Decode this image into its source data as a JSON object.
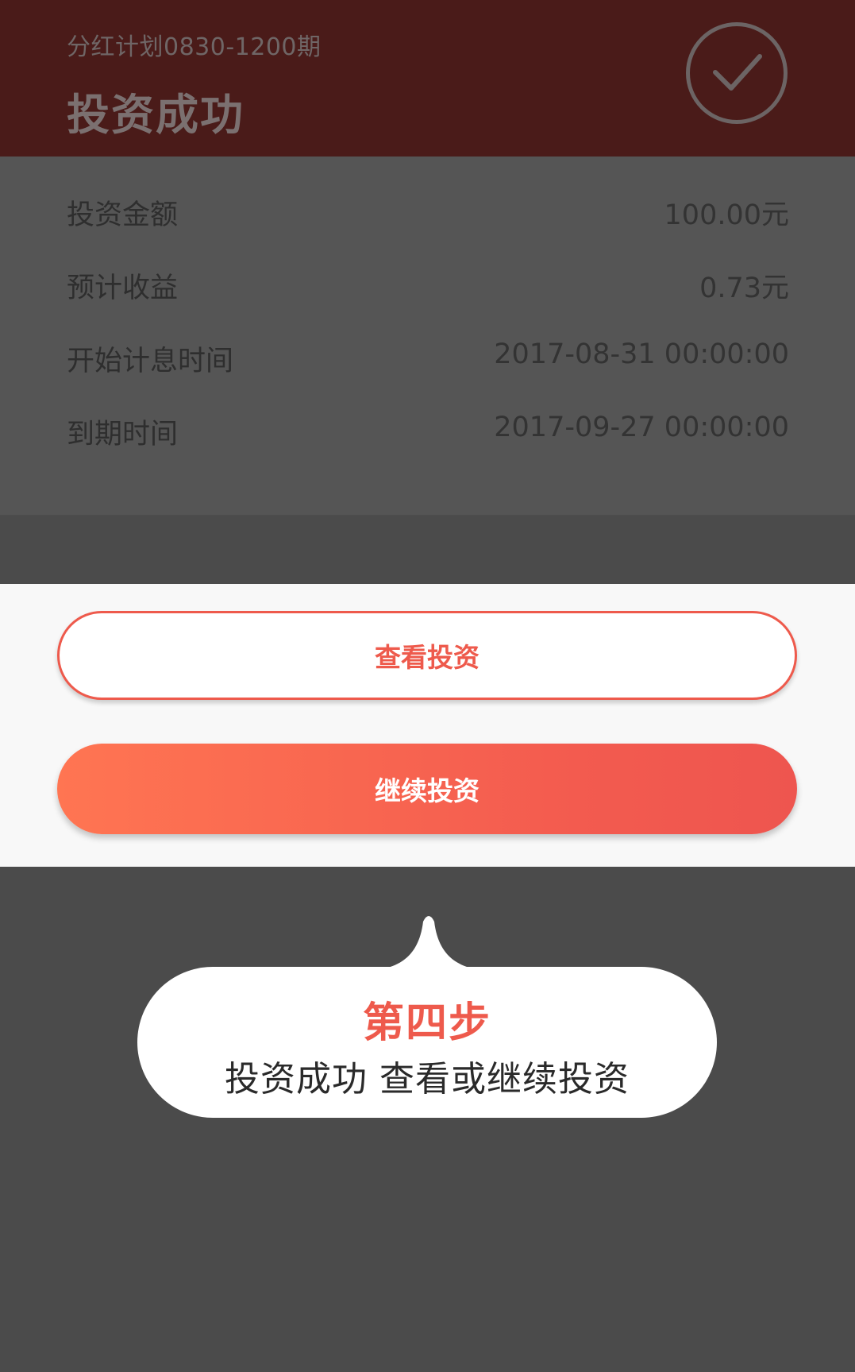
{
  "header": {
    "plan_name": "分红计划0830-1200期",
    "status_title": "投资成功"
  },
  "details": [
    {
      "label": "投资金额",
      "value": "100.00元"
    },
    {
      "label": "预计收益",
      "value": "0.73元"
    },
    {
      "label": "开始计息时间",
      "value": "2017-08-31 00:00:00"
    },
    {
      "label": "到期时间",
      "value": "2017-09-27 00:00:00"
    }
  ],
  "buttons": {
    "view_label": "查看投资",
    "continue_label": "继续投资"
  },
  "tooltip": {
    "step": "第四步",
    "description": "投资成功 查看或继续投资"
  },
  "colors": {
    "accent": "#ee5a4c",
    "header_bg_dimmed": "#4a1b19",
    "overlay": "#4b4b4b"
  },
  "icons": {
    "header_status": "check-circle-icon"
  }
}
